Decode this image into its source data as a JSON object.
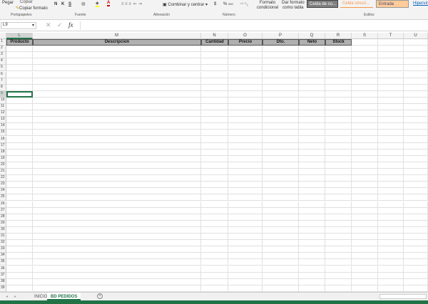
{
  "ribbon": {
    "paste": "Pegar",
    "copy": "Copiar",
    "copy_format": "Copiar formato",
    "bold": "N",
    "italic": "K",
    "underline": "S",
    "merge": "Combinar y centrar",
    "currency": "$",
    "percent": "%",
    "thousands": "000",
    "cond_format": "Formato",
    "cond_format2": "condicional",
    "table_format": "Dar formato",
    "table_format2": "como tabla",
    "groups": [
      "Portapapeles",
      "Fuente",
      "Alineación",
      "Número",
      "Estilos"
    ],
    "styles": [
      {
        "label": "Celda de co...",
        "bg": "#7f7f7f",
        "fg": "#ffffff"
      },
      {
        "label": "Celda vincul...",
        "bg": "#ffffff",
        "fg": "#f79646"
      },
      {
        "label": "Entrada",
        "bg": "#ffcc99",
        "fg": "#3f3f76"
      },
      {
        "label": "Hipervín",
        "bg": "#ffffff",
        "fg": "#0563c1"
      }
    ]
  },
  "formula_bar": {
    "name_box": "L9",
    "fx": "fx",
    "value": ""
  },
  "columns": [
    "L",
    "M",
    "N",
    "O",
    "P",
    "Q",
    "R",
    "S",
    "T",
    "U"
  ],
  "headers": [
    "Producto",
    "Descripcion",
    "Cantidad",
    "Precio",
    "Dto.",
    "Neto",
    "Stock"
  ],
  "rows": [
    1,
    2,
    3,
    4,
    5,
    6,
    7,
    8,
    9,
    10,
    11,
    12,
    13,
    14,
    15,
    16,
    17,
    18,
    19,
    20,
    21,
    22,
    23,
    24,
    25,
    26,
    27,
    28,
    29,
    30,
    31,
    32,
    33,
    34,
    35,
    36,
    37,
    38,
    39
  ],
  "selected": {
    "col": "L",
    "row": 9
  },
  "sheets": [
    {
      "name": "INICIO",
      "active": false
    },
    {
      "name": "BD PEDIDOS",
      "active": true
    }
  ],
  "add_sheet": "+"
}
